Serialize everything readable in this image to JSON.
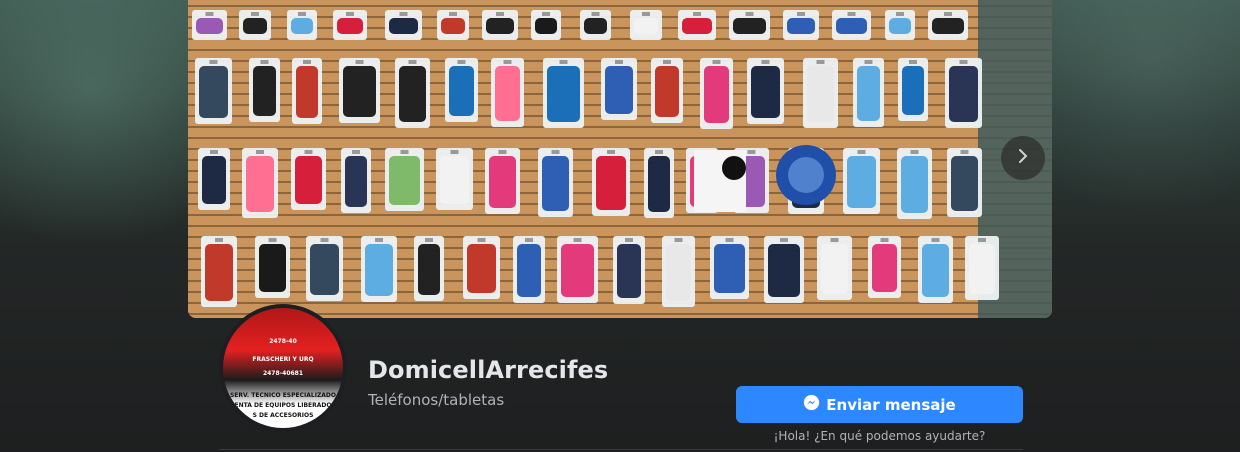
{
  "page": {
    "name": "DomicellArrecifes",
    "category": "Teléfonos/tabletas"
  },
  "cover": {
    "alt": "Pared de exhibición con fundas para celulares y accesorios"
  },
  "actions": {
    "send_message_label": "Enviar mensaje",
    "message_hint": "¡Hola! ¿En qué podemos ayudarte?"
  },
  "avatar": {
    "lines": [
      "2478-40",
      "FRASCHERI Y URQ",
      "2478-40681",
      "SERV. TECNICO ESPECIALIZADO",
      "ENTA DE EQUIPOS LIBERADO",
      "S DE ACCESORIOS"
    ]
  },
  "colors": {
    "accent": "#2d88ff",
    "background": "#1c1e21",
    "primary_text": "#e4e6eb",
    "secondary_text": "#b0b3b8"
  },
  "icons": {
    "next": "chevron-right-icon",
    "messenger": "messenger-icon"
  }
}
